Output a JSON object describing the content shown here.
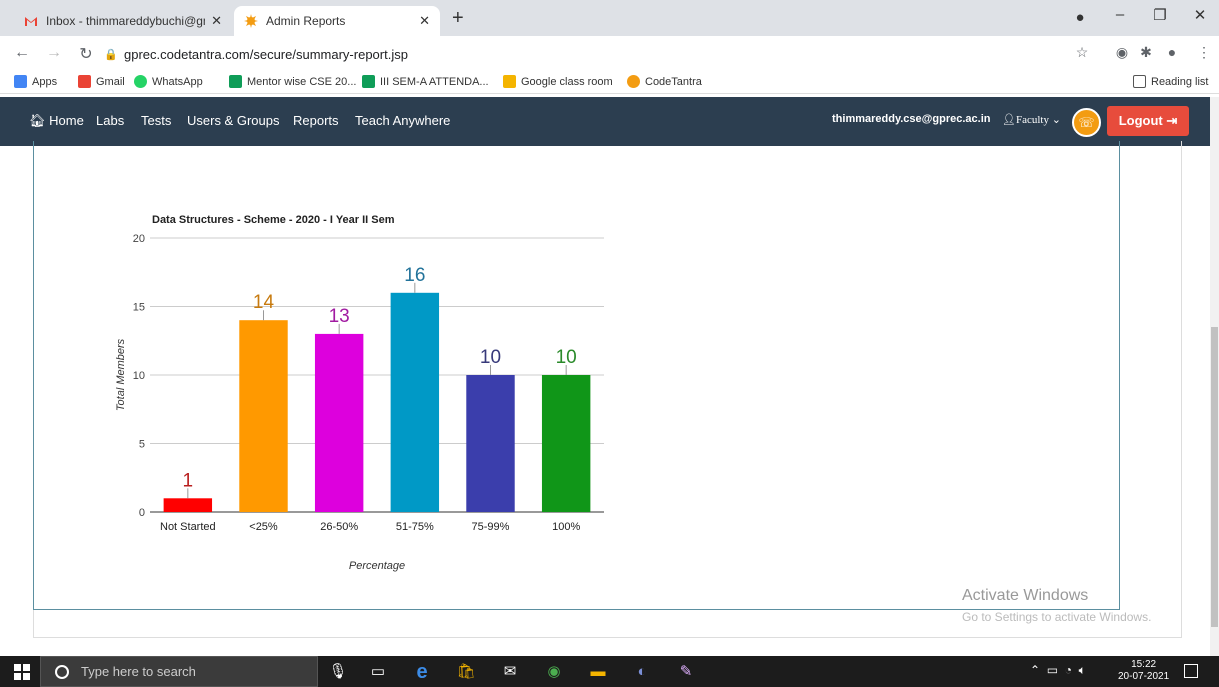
{
  "browser": {
    "tabs": [
      {
        "title": "Inbox - thimmareddybuchi@gma",
        "icon": "gmail-icon"
      },
      {
        "title": "Admin Reports",
        "icon": "codetantra-icon"
      }
    ],
    "new_tab": "+",
    "url": "gprec.codetantra.com/secure/summary-report.jsp",
    "bookmarks": [
      {
        "label": "Apps",
        "color": "#4285f4"
      },
      {
        "label": "Gmail",
        "color": "#ea4335"
      },
      {
        "label": "WhatsApp",
        "color": "#25d366"
      },
      {
        "label": "Mentor wise CSE 20...",
        "color": "#0f9d58"
      },
      {
        "label": "III SEM-A ATTENDA...",
        "color": "#0f9d58"
      },
      {
        "label": "Google class room",
        "color": "#f4b400"
      },
      {
        "label": "CodeTantra",
        "color": "#f39c12"
      }
    ],
    "reading_list": "Reading list"
  },
  "appnav": {
    "items": [
      "Home",
      "Labs",
      "Tests",
      "Users & Groups",
      "Reports",
      "Teach Anywhere"
    ],
    "user_email": "thimmareddy.cse@gprec.ac.in",
    "role": "Faculty",
    "logout": "Logout",
    "bar_color": "#2c3e50",
    "logout_color": "#e74c3c"
  },
  "chart_data": {
    "type": "bar",
    "title": "Data Structures - Scheme - 2020 - I Year II Sem",
    "xlabel": "Percentage",
    "ylabel": "Total Members",
    "categories": [
      "Not Started",
      "<25%",
      "26-50%",
      "51-75%",
      "75-99%",
      "100%"
    ],
    "values": [
      1,
      14,
      13,
      16,
      10,
      10
    ],
    "colors": [
      "#ff0000",
      "#ff9900",
      "#dd00dd",
      "#0099c6",
      "#3b3eac",
      "#109618"
    ],
    "label_colors": [
      "#b91f1f",
      "#c77a0e",
      "#a11ba1",
      "#22739a",
      "#37397a",
      "#2a8a2a"
    ],
    "ylim": [
      0,
      20
    ],
    "yticks": [
      0,
      5,
      10,
      15,
      20
    ],
    "grid": true
  },
  "watermark": {
    "line1": "Activate Windows",
    "line2": "Go to Settings to activate Windows."
  },
  "taskbar": {
    "search_placeholder": "Type here to search",
    "time": "15:22",
    "date": "20-07-2021"
  }
}
